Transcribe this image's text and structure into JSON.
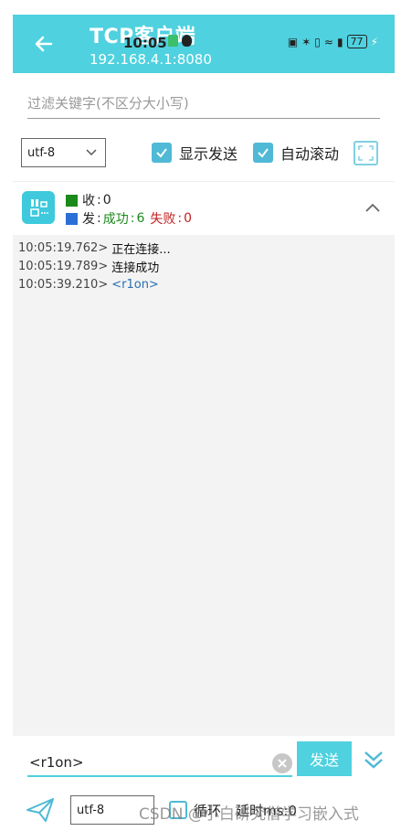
{
  "appbar": {
    "title": "TCP客户端",
    "subtitle": "192.168.4.1:8080",
    "status_time": "10:05",
    "battery": "77"
  },
  "filter": {
    "placeholder": "过滤关键字(不区分大小写)"
  },
  "options": {
    "encoding": "utf-8",
    "show_send": {
      "label": "显示发送",
      "checked": true
    },
    "auto_scroll": {
      "label": "自动滚动",
      "checked": true
    }
  },
  "stats": {
    "recv_label": "收",
    "recv_value": "0",
    "send_label": "发",
    "success_label": "成功",
    "success_value": "6",
    "fail_label": "失败",
    "fail_value": "0"
  },
  "log": [
    {
      "time": "10:05:19.762>",
      "msg": "正在连接...",
      "kind": "info"
    },
    {
      "time": "10:05:19.789>",
      "msg": "连接成功",
      "kind": "info"
    },
    {
      "time": "10:05:39.210>",
      "msg": "<r1on>",
      "kind": "sent"
    }
  ],
  "send": {
    "input_value": "<r1on>",
    "button_label": "发送"
  },
  "bottom": {
    "encoding": "utf-8",
    "loop_label": "循环",
    "delay_label": "延时ms:0",
    "watermark": "CSDN @小白研究僧学习嵌入式"
  },
  "colors": {
    "accent": "#4fd1df",
    "recv": "#1a8a1a",
    "send": "#2a6fd6",
    "success": "#1a8a1a",
    "fail": "#c0201e"
  }
}
